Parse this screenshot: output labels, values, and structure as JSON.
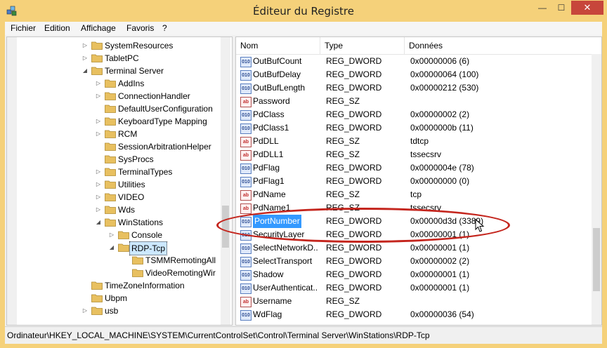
{
  "window": {
    "title": "Éditeur du Registre",
    "min": "—",
    "max": "☐",
    "close": "✕"
  },
  "menu": [
    "Fichier",
    "Edition",
    "Affichage",
    "Favoris",
    "?"
  ],
  "tree": [
    {
      "label": "SystemResources",
      "depth": 0,
      "exp": "▷"
    },
    {
      "label": "TabletPC",
      "depth": 0,
      "exp": "▷"
    },
    {
      "label": "Terminal Server",
      "depth": 0,
      "exp": "◢"
    },
    {
      "label": "AddIns",
      "depth": 1,
      "exp": "▷"
    },
    {
      "label": "ConnectionHandler",
      "depth": 1,
      "exp": "▷"
    },
    {
      "label": "DefaultUserConfiguration",
      "depth": 1,
      "exp": ""
    },
    {
      "label": "KeyboardType Mapping",
      "depth": 1,
      "exp": "▷"
    },
    {
      "label": "RCM",
      "depth": 1,
      "exp": "▷"
    },
    {
      "label": "SessionArbitrationHelper",
      "depth": 1,
      "exp": ""
    },
    {
      "label": "SysProcs",
      "depth": 1,
      "exp": ""
    },
    {
      "label": "TerminalTypes",
      "depth": 1,
      "exp": "▷"
    },
    {
      "label": "Utilities",
      "depth": 1,
      "exp": "▷"
    },
    {
      "label": "VIDEO",
      "depth": 1,
      "exp": "▷"
    },
    {
      "label": "Wds",
      "depth": 1,
      "exp": "▷"
    },
    {
      "label": "WinStations",
      "depth": 1,
      "exp": "◢"
    },
    {
      "label": "Console",
      "depth": 2,
      "exp": "▷"
    },
    {
      "label": "RDP-Tcp",
      "depth": 2,
      "exp": "◢",
      "selected": true
    },
    {
      "label": "TSMMRemotingAll",
      "depth": 3,
      "exp": ""
    },
    {
      "label": "VideoRemotingWir",
      "depth": 3,
      "exp": ""
    },
    {
      "label": "TimeZoneInformation",
      "depth": 0,
      "exp": ""
    },
    {
      "label": "Ubpm",
      "depth": 0,
      "exp": ""
    },
    {
      "label": "usb",
      "depth": 0,
      "exp": "▷"
    }
  ],
  "columns": [
    "Nom",
    "Type",
    "Données"
  ],
  "values": [
    {
      "icon": "dword",
      "name": "OutBufCount",
      "type": "REG_DWORD",
      "data": "0x00000006 (6)"
    },
    {
      "icon": "dword",
      "name": "OutBufDelay",
      "type": "REG_DWORD",
      "data": "0x00000064 (100)"
    },
    {
      "icon": "dword",
      "name": "OutBufLength",
      "type": "REG_DWORD",
      "data": "0x00000212 (530)"
    },
    {
      "icon": "sz",
      "name": "Password",
      "type": "REG_SZ",
      "data": ""
    },
    {
      "icon": "dword",
      "name": "PdClass",
      "type": "REG_DWORD",
      "data": "0x00000002 (2)"
    },
    {
      "icon": "dword",
      "name": "PdClass1",
      "type": "REG_DWORD",
      "data": "0x0000000b (11)"
    },
    {
      "icon": "sz",
      "name": "PdDLL",
      "type": "REG_SZ",
      "data": "tdtcp"
    },
    {
      "icon": "sz",
      "name": "PdDLL1",
      "type": "REG_SZ",
      "data": "tssecsrv"
    },
    {
      "icon": "dword",
      "name": "PdFlag",
      "type": "REG_DWORD",
      "data": "0x0000004e (78)"
    },
    {
      "icon": "dword",
      "name": "PdFlag1",
      "type": "REG_DWORD",
      "data": "0x00000000 (0)"
    },
    {
      "icon": "sz",
      "name": "PdName",
      "type": "REG_SZ",
      "data": "tcp"
    },
    {
      "icon": "sz",
      "name": "PdName1",
      "type": "REG_SZ",
      "data": "tssecsrv"
    },
    {
      "icon": "dword",
      "name": "PortNumber",
      "type": "REG_DWORD",
      "data": "0x00000d3d (3389)",
      "selected": true
    },
    {
      "icon": "dword",
      "name": "SecurityLayer",
      "type": "REG_DWORD",
      "data": "0x00000001 (1)"
    },
    {
      "icon": "dword",
      "name": "SelectNetworkD...",
      "type": "REG_DWORD",
      "data": "0x00000001 (1)"
    },
    {
      "icon": "dword",
      "name": "SelectTransport",
      "type": "REG_DWORD",
      "data": "0x00000002 (2)"
    },
    {
      "icon": "dword",
      "name": "Shadow",
      "type": "REG_DWORD",
      "data": "0x00000001 (1)"
    },
    {
      "icon": "dword",
      "name": "UserAuthenticat...",
      "type": "REG_DWORD",
      "data": "0x00000001 (1)"
    },
    {
      "icon": "sz",
      "name": "Username",
      "type": "REG_SZ",
      "data": ""
    },
    {
      "icon": "dword",
      "name": "WdFlag",
      "type": "REG_DWORD",
      "data": "0x00000036 (54)"
    }
  ],
  "status": "Ordinateur\\HKEY_LOCAL_MACHINE\\SYSTEM\\CurrentControlSet\\Control\\Terminal Server\\WinStations\\RDP-Tcp",
  "colors": {
    "title_bg": "#f5d17a",
    "close": "#c7463b",
    "selection": "#3399ff",
    "annotation": "#c4251d",
    "folder": "#e8c060"
  }
}
